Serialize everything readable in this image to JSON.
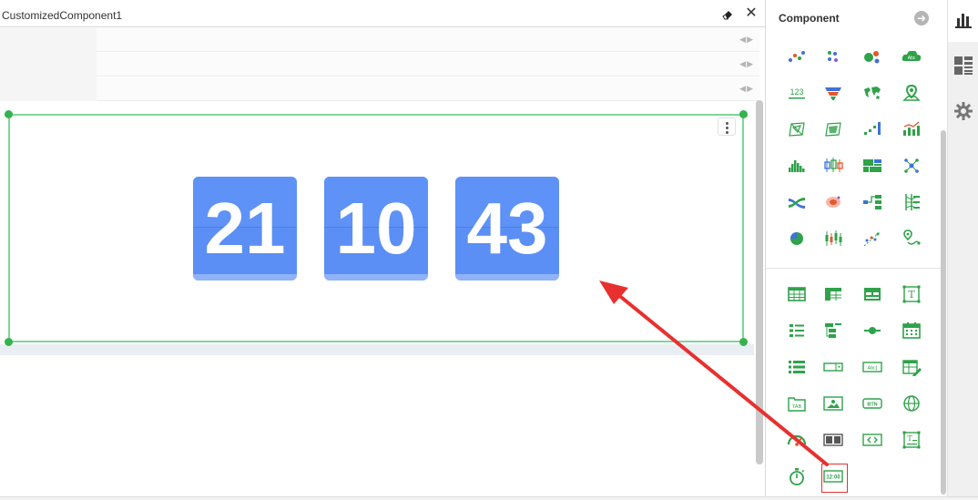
{
  "editor": {
    "title": "CustomizedComponent1",
    "clock": {
      "hours": "21",
      "minutes": "10",
      "seconds": "43",
      "tile_color": "#5b8ff5"
    }
  },
  "panel": {
    "title": "Component",
    "accent": "#2fa24a",
    "highlight": "#e13232",
    "chart_icons": [
      "scatter-chart-icon",
      "dot-chart-icon",
      "bubble-chart-icon",
      "word-cloud-icon",
      "number-kpi-icon",
      "funnel-chart-icon",
      "world-map-icon",
      "location-map-icon",
      "radar-chart-icon",
      "area-radar-chart-icon",
      "step-chart-icon",
      "bar-line-chart-icon",
      "histogram-icon",
      "box-plot-icon",
      "treemap-icon",
      "network-graph-icon",
      "sankey-chart-icon",
      "heat-map-icon",
      "tree-chart-icon",
      "parallel-axis-icon",
      "pie-globe-icon",
      "candlestick-chart-icon",
      "scatter-trend-icon",
      "route-map-icon"
    ],
    "widget_icons": [
      "table-icon",
      "crosstab-icon",
      "freehand-table-icon",
      "text-box-icon",
      "list-icon",
      "tree-list-icon",
      "slider-icon",
      "calendar-icon",
      "selection-list-icon",
      "combo-box-icon",
      "text-input-icon",
      "form-edit-icon",
      "tab-icon",
      "image-icon",
      "button-icon",
      "web-icon",
      "gauge-icon",
      "layout-icon",
      "embedded-code-icon",
      "formula-box-icon",
      "stopwatch-icon",
      "digital-clock-icon"
    ]
  }
}
